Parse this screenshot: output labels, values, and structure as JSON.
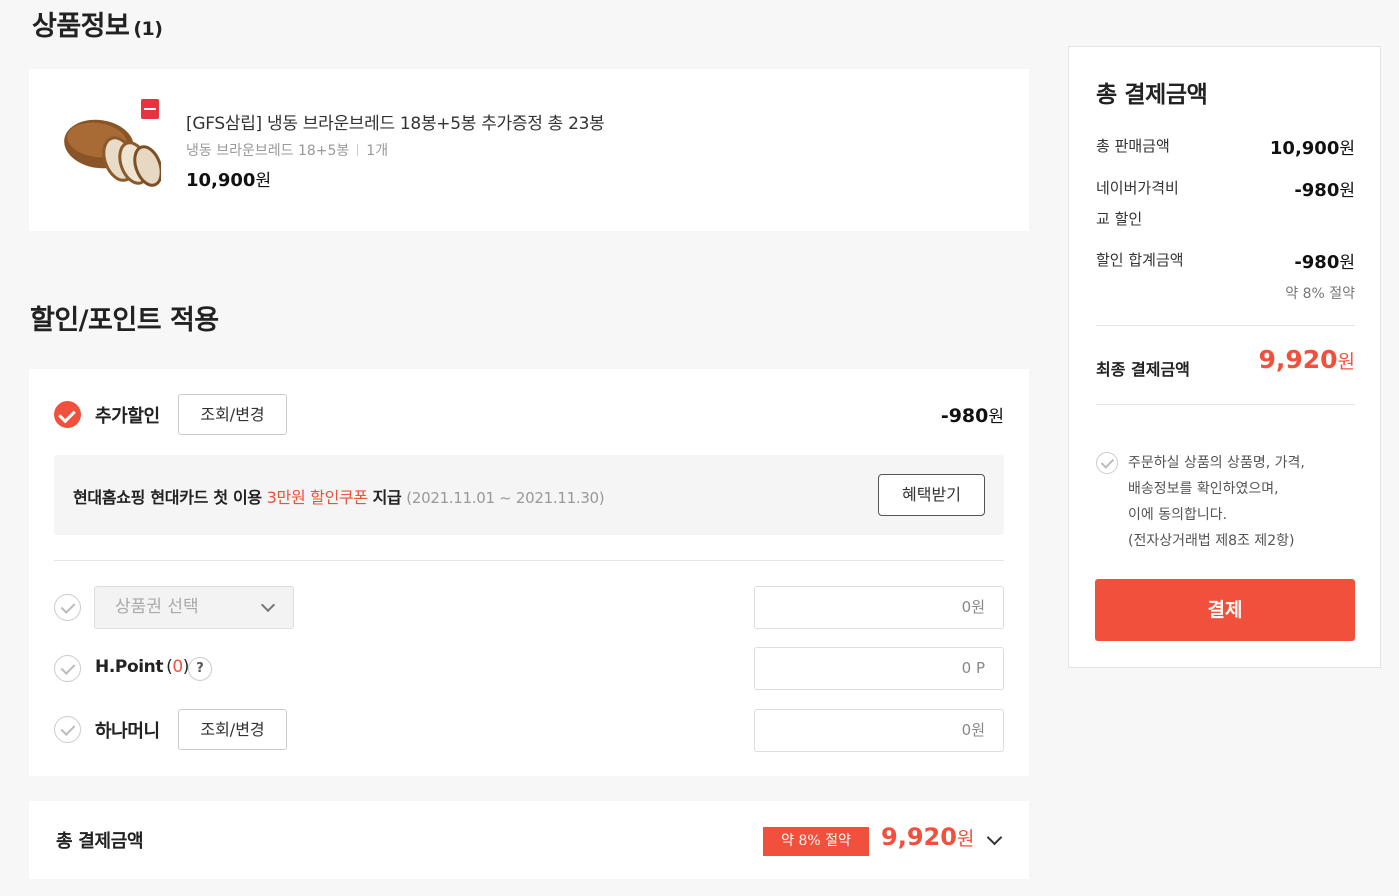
{
  "product_section": {
    "title": "상품정보",
    "count": "(1)",
    "item": {
      "name": "[GFS삼립] 냉동 브라운브레드 18봉+5봉 추가증정 총 23봉",
      "option": "냉동 브라운브레드 18+5봉",
      "quantity": "1개",
      "price": "10,900",
      "currency": "원"
    }
  },
  "discount_section": {
    "title": "할인/포인트 적용",
    "extra_discount": {
      "label": "추가할인",
      "button": "조회/변경",
      "amount": "-980",
      "currency": "원"
    },
    "promo": {
      "text1": "현대홈쇼핑 현대카드 첫 이용",
      "highlight": "3만원 할인쿠폰",
      "text2": "지급",
      "period": "(2021.11.01 ~ 2021.11.30)",
      "button": "혜택받기"
    },
    "gift_card": {
      "select_label": "상품권 선택",
      "value": "0원"
    },
    "hpoint": {
      "label": "H.Point",
      "open": "(",
      "balance": "0",
      "close": ")",
      "help": "?",
      "value": "0 P"
    },
    "hanamoney": {
      "label": "하나머니",
      "button": "조회/변경",
      "value": "0원"
    }
  },
  "bottom_total": {
    "label": "총 결제금액",
    "save_badge": "약 8% 절약",
    "amount": "9,920",
    "currency": "원"
  },
  "summary": {
    "title": "총 결제금액",
    "rows": [
      {
        "label": "총 판매금액",
        "value": "10,900"
      },
      {
        "label": "네이버가격비",
        "label2": "교 할인",
        "value": "-980"
      },
      {
        "label": "할인 합계금액",
        "value": "-980"
      }
    ],
    "currency": "원",
    "save_note": "약 8% 절약",
    "final_label": "최종 결제금액",
    "final_value": "9,920",
    "agree_lines": [
      "주문하실 상품의 상품명, 가격,",
      "배송정보를 확인하였으며,",
      "이에 동의합니다.",
      "(전자상거래법 제8조 제2항)"
    ],
    "pay_button": "결제"
  },
  "colors": {
    "accent": "#f1503c",
    "background": "#f7f7f7"
  }
}
